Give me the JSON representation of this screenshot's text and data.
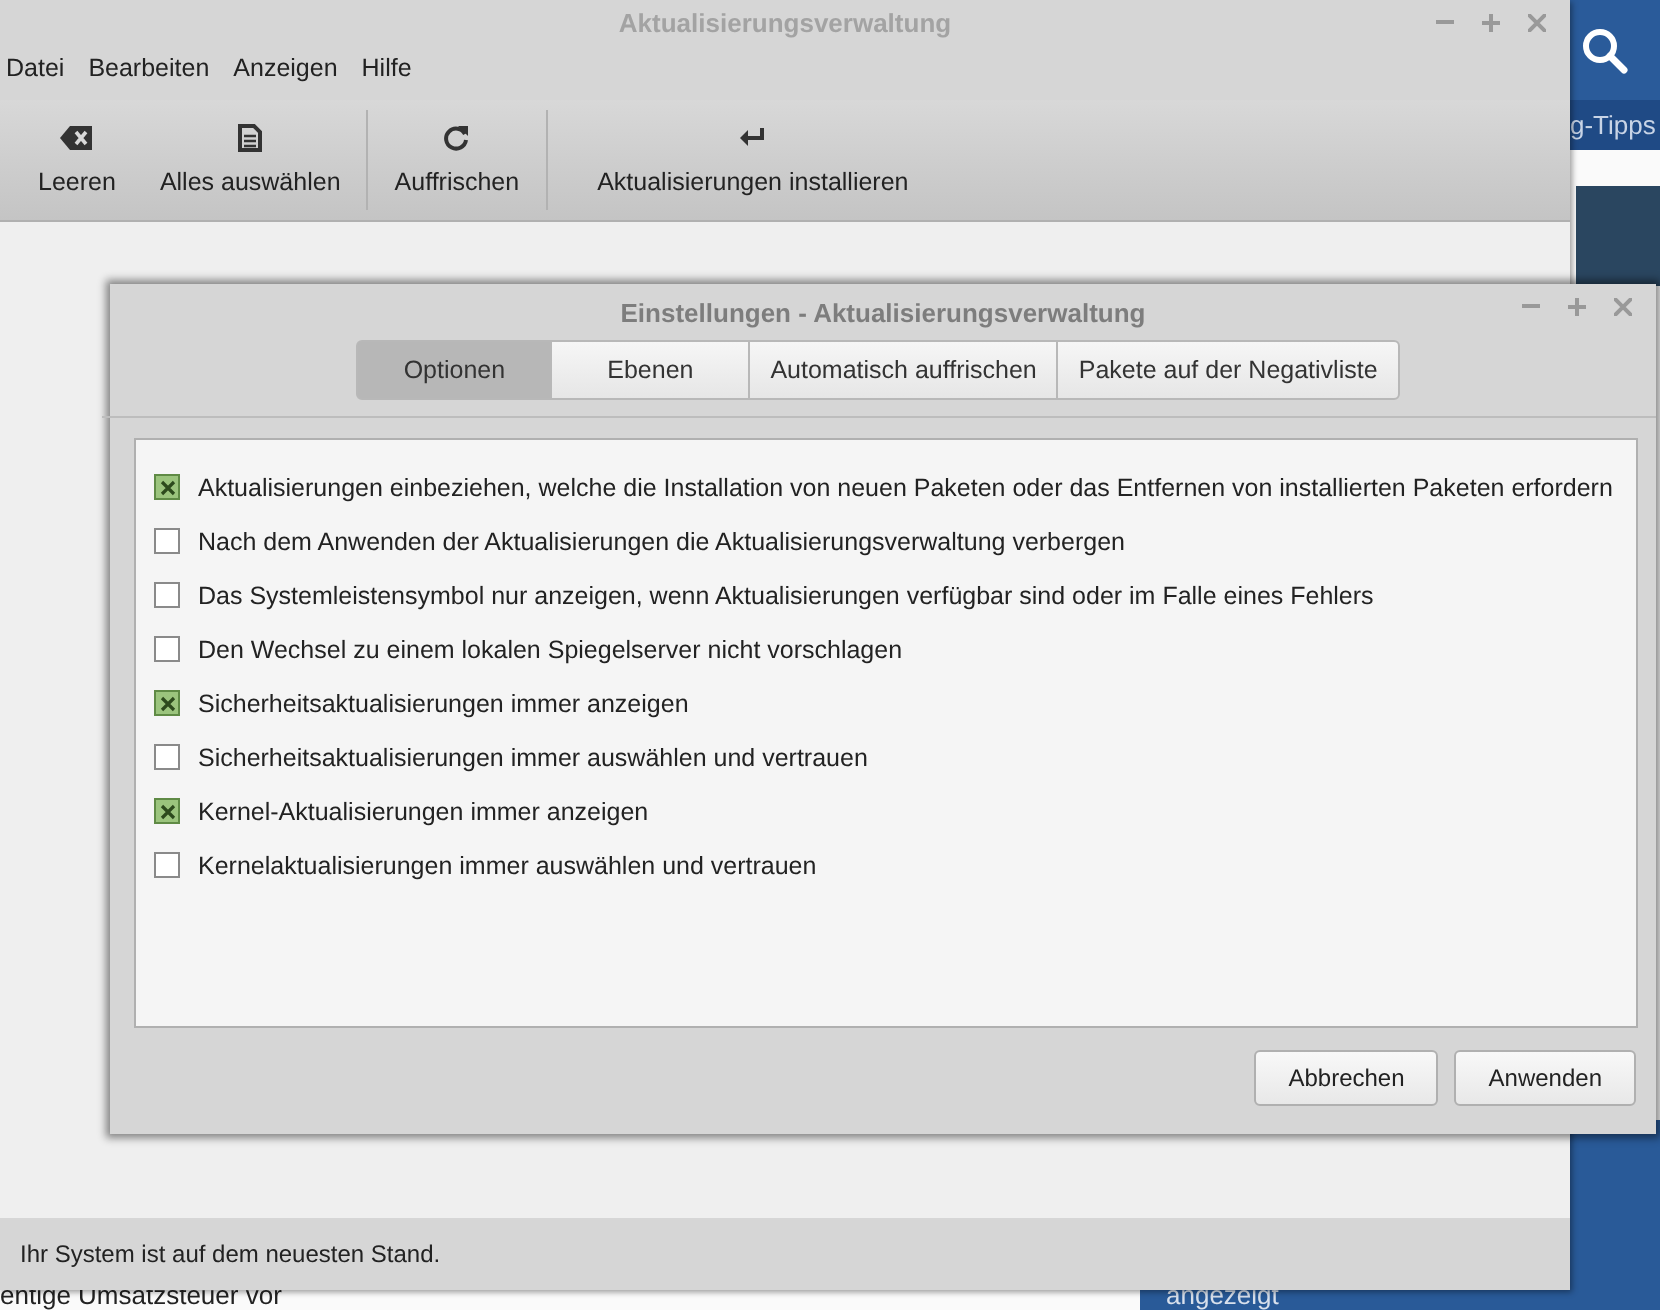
{
  "background_page": {
    "header_text": "g-Tipps",
    "bottom_left_text": "entige Umsatzsteuer vor",
    "bottom_right_text": "angezeigt"
  },
  "window": {
    "title": "Aktualisierungsverwaltung",
    "menu": [
      "Datei",
      "Bearbeiten",
      "Anzeigen",
      "Hilfe"
    ],
    "toolbar": [
      {
        "label": "Leeren",
        "kind": "clear"
      },
      {
        "label": "Alles auswählen",
        "kind": "select"
      },
      {
        "label": "Auffrischen",
        "kind": "refresh"
      },
      {
        "label": "Aktualisierungen installieren",
        "kind": "install"
      }
    ],
    "status_bar": "Ihr System ist auf dem neuesten Stand."
  },
  "dialog": {
    "title": "Einstellungen - Aktualisierungsverwaltung",
    "tabs": [
      {
        "label": "Optionen",
        "selected": true
      },
      {
        "label": "Ebenen",
        "selected": false
      },
      {
        "label": "Automatisch auffrischen",
        "selected": false
      },
      {
        "label": "Pakete auf der Negativliste",
        "selected": false
      }
    ],
    "options": [
      {
        "label": "Aktualisierungen einbeziehen, welche die Installation von neuen Paketen oder das Entfernen von installierten Paketen erfordern",
        "checked": true
      },
      {
        "label": "Nach dem Anwenden der Aktualisierungen die Aktualisierungsverwaltung verbergen",
        "checked": false
      },
      {
        "label": "Das Systemleistensymbol nur anzeigen, wenn Aktualisierungen verfügbar sind oder im Falle eines Fehlers",
        "checked": false
      },
      {
        "label": "Den Wechsel zu einem lokalen Spiegelserver nicht vorschlagen",
        "checked": false
      },
      {
        "label": "Sicherheitsaktualisierungen immer anzeigen",
        "checked": true
      },
      {
        "label": "Sicherheitsaktualisierungen immer auswählen und vertrauen",
        "checked": false
      },
      {
        "label": "Kernel-Aktualisierungen immer anzeigen",
        "checked": true
      },
      {
        "label": "Kernelaktualisierungen immer auswählen und vertrauen",
        "checked": false
      }
    ],
    "buttons": [
      "Abbrechen",
      "Anwenden"
    ]
  }
}
